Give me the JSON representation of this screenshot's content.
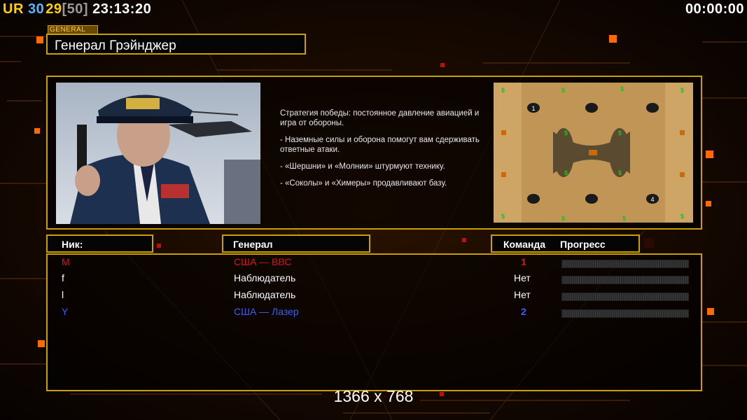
{
  "hud": {
    "tag": "UR",
    "fps": "30",
    "fps2": "29",
    "fps_limit": "[50]",
    "clock": "23:13:20",
    "timer": "00:00:00"
  },
  "header": {
    "tag": "GENERAL",
    "title": "Генерал Грэйнджер"
  },
  "description": {
    "line1": "Стратегия победы: постоянное давление авиацией и игра от обороны.",
    "line2": "- Наземные силы и оборона помогут вам сдерживать ответные атаки.",
    "line3": "- «Шершни» и «Молнии» штурмуют технику.",
    "line4": "- «Соколы» и «Химеры» продавливают базу."
  },
  "minimap": {
    "start1": "1",
    "start4": "4",
    "money_symbol": "$"
  },
  "columns": {
    "nick": "Ник:",
    "general": "Генерал",
    "team": "Команда",
    "progress": "Прогресс"
  },
  "players": [
    {
      "nick": "M",
      "general": "США — ВВС",
      "team": "1",
      "color": "#e01010"
    },
    {
      "nick": "f",
      "general": "Наблюдатель",
      "team": "Нет",
      "color": "#ffffff"
    },
    {
      "nick": "l",
      "general": "Наблюдатель",
      "team": "Нет",
      "color": "#ffffff"
    },
    {
      "nick": "Y",
      "general": "США — Лазер",
      "team": "2",
      "color": "#3a5cff"
    }
  ],
  "resolution_label": "1366 x 768",
  "colors": {
    "accent": "#c9a000",
    "orange": "#ff7a10"
  }
}
